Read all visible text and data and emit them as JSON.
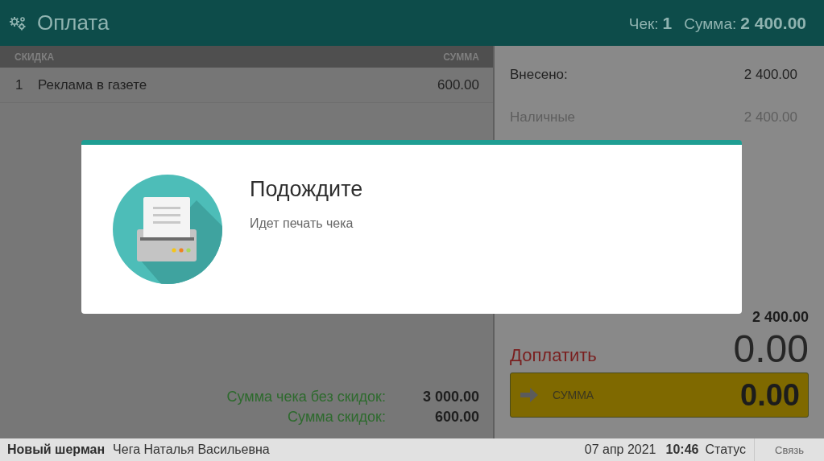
{
  "header": {
    "title": "Оплата",
    "check_label": "Чек:",
    "check_number": "1",
    "sum_label": "Сумма:",
    "sum_value": "2 400.00"
  },
  "discounts": {
    "columns": [
      "СКИДКА",
      "СУММА"
    ],
    "rows": [
      {
        "number": "1",
        "name": "Реклама в газете",
        "amount": "600.00"
      }
    ]
  },
  "totals": [
    {
      "label": "Сумма чека без скидок:",
      "value": "3 000.00"
    },
    {
      "label": "Сумма скидок:",
      "value": "600.00"
    }
  ],
  "payment": {
    "deposited_label": "Внесено:",
    "deposited_value": "2 400.00",
    "methods": [
      {
        "name": "Наличные",
        "value": "2 400.00"
      }
    ],
    "total_value": "2 400.00",
    "due_label": "Доплатить",
    "due_value": "0.00",
    "input": {
      "label": "СУММА",
      "value": "0.00"
    }
  },
  "dialog": {
    "title": "Подождите",
    "message": "Идет печать чека"
  },
  "status_bar": {
    "shop": "Новый шерман",
    "cashier": "Чега Наталья Васильевна",
    "date": "07 апр 2021",
    "time": "10:46",
    "status": "Статус",
    "connection": "Связь"
  }
}
